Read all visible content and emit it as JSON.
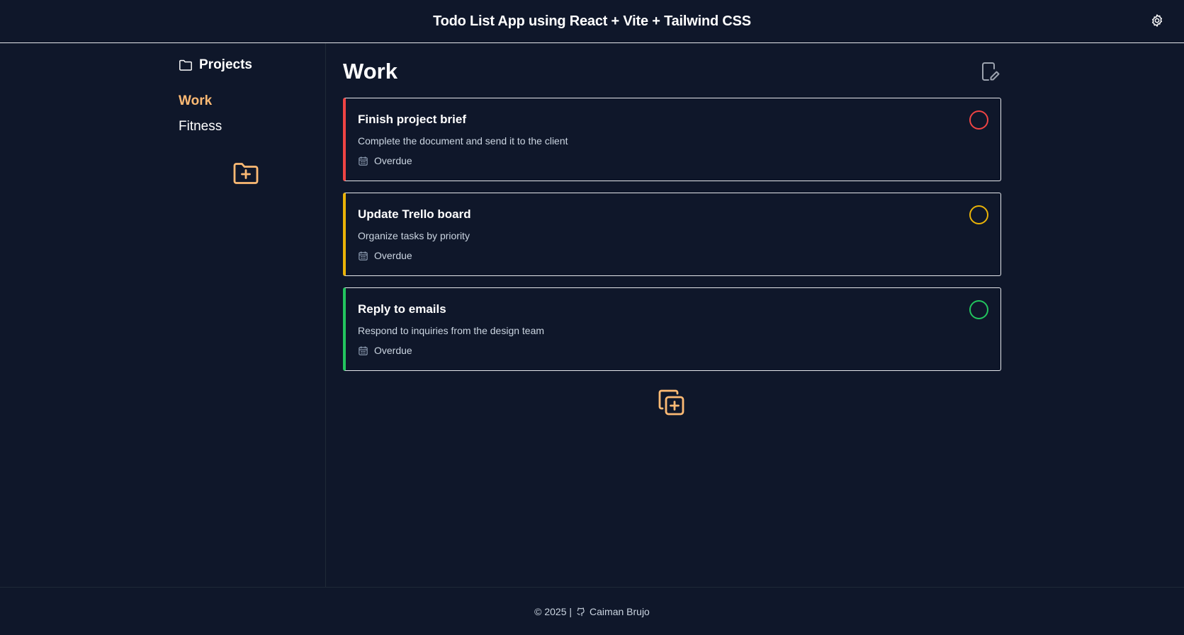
{
  "header": {
    "title": "Todo List App using React + Vite + Tailwind CSS",
    "settings_icon": "gear-icon"
  },
  "sidebar": {
    "heading": "Projects",
    "heading_icon": "folder-icon",
    "projects": [
      {
        "label": "Work",
        "active": true
      },
      {
        "label": "Fitness",
        "active": false
      }
    ],
    "add_project_icon": "folder-plus-icon"
  },
  "main": {
    "title": "Work",
    "edit_icon": "edit-document-icon",
    "tasks": [
      {
        "title": "Finish project brief",
        "description": "Complete the document and send it to the client",
        "due": "Overdue",
        "priority_color": "#ef4444"
      },
      {
        "title": "Update Trello board",
        "description": "Organize tasks by priority",
        "due": "Overdue",
        "priority_color": "#eab308"
      },
      {
        "title": "Reply to emails",
        "description": "Respond to inquiries from the design team",
        "due": "Overdue",
        "priority_color": "#22c55e"
      }
    ],
    "add_task_icon": "copy-plus-icon"
  },
  "footer": {
    "copyright": "© 2025 |",
    "author": "Caiman Brujo",
    "author_icon": "github-icon"
  },
  "colors": {
    "background": "#0f172a",
    "accent": "#fdba74",
    "text_muted": "#cbd5e1"
  }
}
